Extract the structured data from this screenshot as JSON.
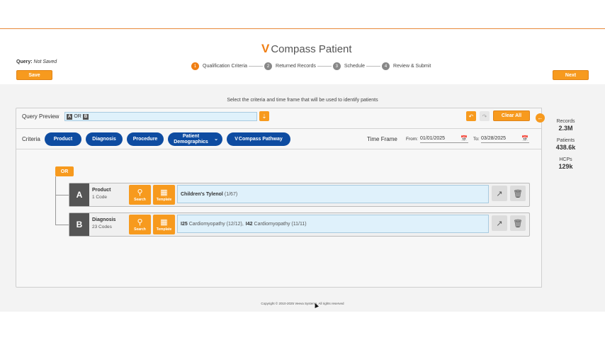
{
  "app": {
    "logo_mark": "V",
    "logo_text": "Compass Patient",
    "query_label": "Query:",
    "query_status": "Not Saved",
    "save_label": "Save",
    "next_label": "Next"
  },
  "steps": [
    {
      "num": "1",
      "label": "Qualification Criteria",
      "active": true
    },
    {
      "num": "2",
      "label": "Returned Records",
      "active": false
    },
    {
      "num": "3",
      "label": "Schedule",
      "active": false
    },
    {
      "num": "4",
      "label": "Review & Submit",
      "active": false
    }
  ],
  "instructions": "Select the criteria and time frame that will be used to identify patients",
  "query_preview": {
    "label": "Query Preview",
    "tag_a": "A",
    "op": "OR",
    "tag_b": "B",
    "clear_all_label": "Clear All"
  },
  "criteria": {
    "label": "Criteria",
    "buttons": {
      "product": "Product",
      "diagnosis": "Diagnosis",
      "procedure": "Procedure",
      "patient_demographics": "Patient Demographics",
      "compass_pathway": "Compass Pathway"
    },
    "time_frame_label": "Time Frame",
    "from_label": "From:",
    "from_value": "01/01/2025",
    "to_label": "To:",
    "to_value": "03/28/2025"
  },
  "stats": {
    "records_label": "Records",
    "records_value": "2.3M",
    "patients_label": "Patients",
    "patients_value": "438.6k",
    "hcps_label": "HCPs",
    "hcps_value": "129k"
  },
  "logic": {
    "or_label": "OR"
  },
  "blocks": {
    "a": {
      "letter": "A",
      "title": "Product",
      "subtitle": "1 Code",
      "search_label": "Search",
      "template_label": "Template",
      "code_name": "Children's Tylenol",
      "code_count": "(1/67)"
    },
    "b": {
      "letter": "B",
      "title": "Diagnosis",
      "subtitle": "23 Codes",
      "search_label": "Search",
      "template_label": "Template",
      "code1_id": "I25",
      "code1_text": "Cardiomyopathy (12/12),",
      "code2_id": "I42",
      "code2_text": "Cardiomyopathy (11/11)"
    }
  },
  "footer": "Copyright © 2010-2025 Veeva Systems. All rights reserved",
  "colors": {
    "accent_orange": "#f79a1e",
    "pill_blue": "#0e4ca1",
    "code_box": "#dff1fb"
  }
}
